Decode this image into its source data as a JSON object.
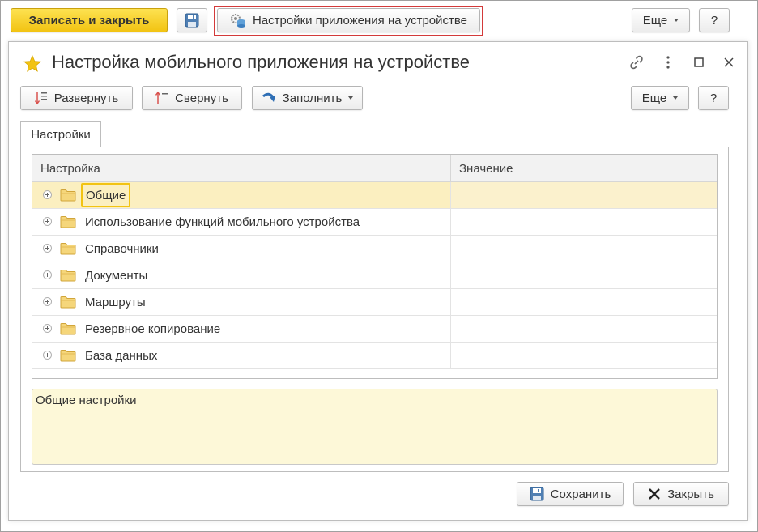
{
  "toolbar": {
    "save_close": "Записать и закрыть",
    "device_settings": "Настройки приложения на устройстве",
    "more": "Еще",
    "help": "?"
  },
  "window": {
    "title": "Настройка мобильного приложения на устройстве",
    "toolbar": {
      "expand": "Развернуть",
      "collapse": "Свернуть",
      "fill": "Заполнить",
      "more": "Еще",
      "help": "?"
    },
    "tab": "Настройки",
    "grid": {
      "columns": [
        "Настройка",
        "Значение"
      ],
      "rows": [
        {
          "label": "Общие",
          "value": ""
        },
        {
          "label": "Использование функций мобильного устройства",
          "value": ""
        },
        {
          "label": "Справочники",
          "value": ""
        },
        {
          "label": "Документы",
          "value": ""
        },
        {
          "label": "Маршруты",
          "value": ""
        },
        {
          "label": "Резервное копирование",
          "value": ""
        },
        {
          "label": "База данных",
          "value": ""
        }
      ]
    },
    "description": "Общие настройки",
    "footer": {
      "save": "Сохранить",
      "close": "Закрыть"
    }
  },
  "colors": {
    "primary_button": "#f2c312",
    "highlight": "#d33a3a",
    "selected_row": "#fbefc0",
    "description_bg": "#fdf8d8"
  }
}
